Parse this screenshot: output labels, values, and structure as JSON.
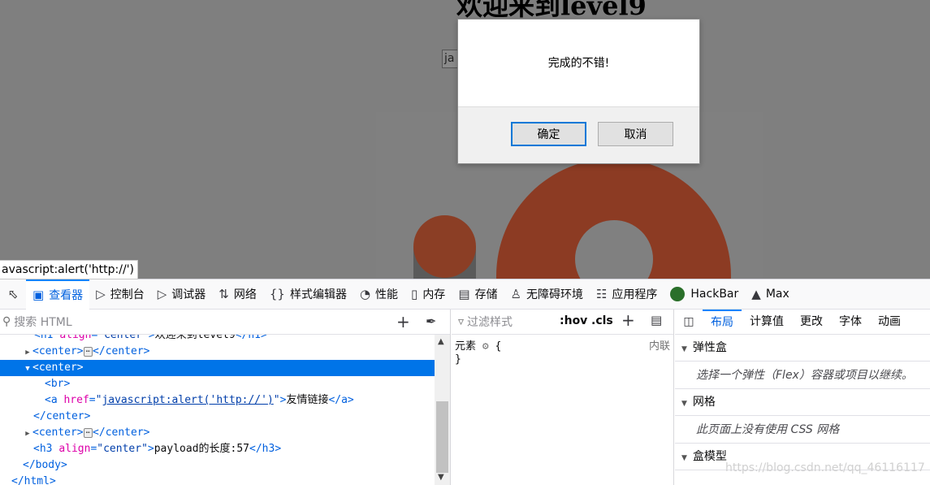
{
  "page": {
    "heading": "欢迎来到level9",
    "input_value": "ja"
  },
  "dialog": {
    "message": "完成的不错!",
    "ok_label": "确定",
    "cancel_label": "取消"
  },
  "status_bar": {
    "url": "avascript:alert('http://')"
  },
  "devtools": {
    "tabs": [
      {
        "label": "查看器",
        "icon": "inspector-icon"
      },
      {
        "label": "控制台",
        "icon": "console-icon"
      },
      {
        "label": "调试器",
        "icon": "debugger-icon"
      },
      {
        "label": "网络",
        "icon": "network-icon"
      },
      {
        "label": "样式编辑器",
        "icon": "style-editor-icon"
      },
      {
        "label": "性能",
        "icon": "performance-icon"
      },
      {
        "label": "内存",
        "icon": "memory-icon"
      },
      {
        "label": "存储",
        "icon": "storage-icon"
      },
      {
        "label": "无障碍环境",
        "icon": "accessibility-icon"
      },
      {
        "label": "应用程序",
        "icon": "application-icon"
      },
      {
        "label": "HackBar",
        "icon": "hackbar-icon"
      },
      {
        "label": "Max",
        "icon": "max-icon"
      }
    ],
    "markup_search_placeholder": "搜索 HTML",
    "tree": {
      "h1_attr": "align",
      "h1_val": "\"center\"",
      "h1_text": "欢迎来到level9",
      "center_tag": "center",
      "br_tag": "br",
      "a_attr": "href",
      "a_val": "javascript:alert('http://')",
      "a_text": "友情链接",
      "h3_attr": "align",
      "h3_val": "\"center\"",
      "h3_text": "payload的长度:57",
      "body_close": "</body>",
      "html_close": "</html>"
    },
    "rules": {
      "filter_placeholder": "过滤样式",
      "hov": ":hov",
      "cls": ".cls",
      "element_selector": "元素",
      "open_brace": "{",
      "close_brace": "}",
      "inline_label": "内联"
    },
    "layout_tabs": [
      "布局",
      "计算值",
      "更改",
      "字体",
      "动画"
    ],
    "sections": [
      {
        "title": "弹性盒",
        "body": "选择一个弹性（Flex）容器或项目以继续。"
      },
      {
        "title": "网格",
        "body": "此页面上没有使用 CSS 网格"
      },
      {
        "title": "盒模型",
        "body": ""
      }
    ]
  },
  "watermark": "https://blog.csdn.net/qq_46116117",
  "colors": {
    "accent": "#0a84ff",
    "selection": "#0074e8",
    "tag": "#0060df",
    "attr": "#dd00a9",
    "overlay": "#7f7f7f",
    "ring": "#8c3b23"
  }
}
